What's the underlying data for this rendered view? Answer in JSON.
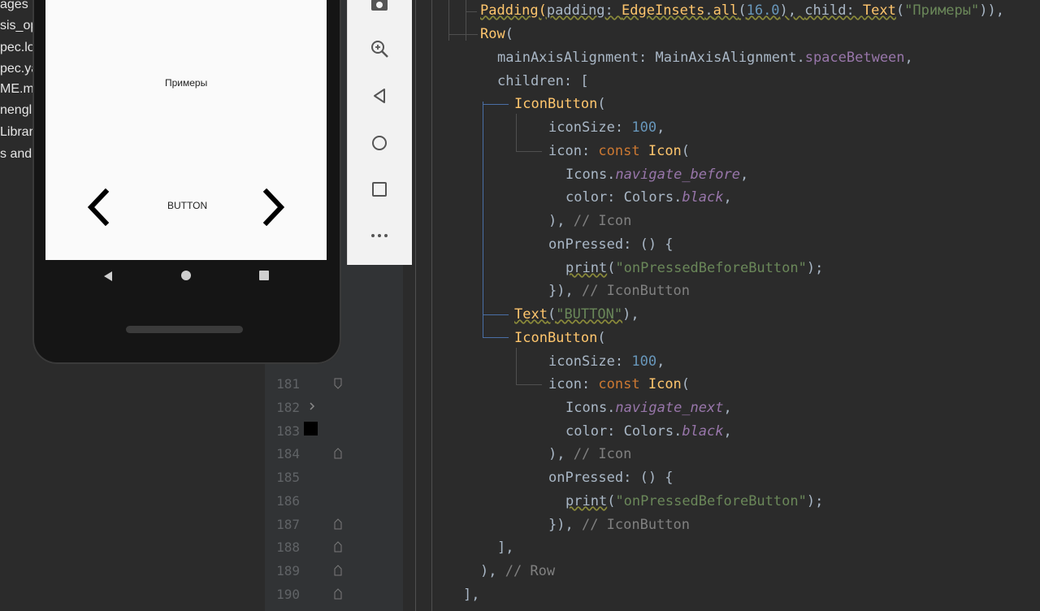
{
  "sidebar": {
    "files": [
      "ages",
      "sis_op",
      "pec.lo",
      "pec.ya",
      "ME.m",
      "nenglis",
      "Librar",
      "s and"
    ]
  },
  "phone": {
    "screen": {
      "title": "Примеры",
      "button_label": "BUTTON",
      "left_icon": "chevron-left-icon",
      "right_icon": "chevron-right-icon"
    },
    "navbar_icons": [
      "back-triangle-icon",
      "home-circle-icon",
      "recents-square-icon"
    ]
  },
  "emulator_toolbar": {
    "tools": [
      "camera-icon",
      "zoom-icon",
      "back-icon",
      "home-icon",
      "overview-icon",
      "more-icon"
    ]
  },
  "editor": {
    "line_numbers": [
      "181",
      "182",
      "183",
      "184",
      "185",
      "186",
      "187",
      "188",
      "189",
      "190"
    ],
    "lines": {
      "l1_a": "Padding(",
      "l1_b": "padding: ",
      "l1_c": "EdgeInsets",
      "l1_d": ".",
      "l1_e": "all",
      "l1_f": "(",
      "l1_g": "16.0",
      "l1_h": "), ",
      "l1_i": "child: ",
      "l1_j": "Text",
      "l1_k": "(",
      "l1_l": "\"Примеры\"",
      "l1_m": ")),",
      "l2_a": "Row",
      "l2_b": "(",
      "l3_a": "mainAxisAlignment: ",
      "l3_b": "MainAxisAlignment.",
      "l3_c": "spaceBetween",
      "l3_d": ",",
      "l4_a": "children: [",
      "l5_a": "IconButton",
      "l5_b": "(",
      "l6_a": "iconSize: ",
      "l6_b": "100",
      "l6_c": ",",
      "l7_a": "icon: ",
      "l7_b": "const ",
      "l7_c": "Icon",
      "l7_d": "(",
      "l8_a": "Icons.",
      "l8_b": "navigate_before",
      "l8_c": ",",
      "l9_a": "color: ",
      "l9_b": "Colors.",
      "l9_c": "black",
      "l9_d": ",",
      "l10_a": "), ",
      "l10_b": "// Icon",
      "l11_a": "onPressed: () {",
      "l12_a": "print",
      "l12_b": "(",
      "l12_c": "\"onPressedBeforeButton\"",
      "l12_d": ");",
      "l13_a": "}), ",
      "l13_b": "// IconButton",
      "l14_a": "Text",
      "l14_b": "(",
      "l14_c": "\"BUTTON\"",
      "l14_d": "),",
      "l15_a": "IconButton",
      "l15_b": "(",
      "l16_a": "iconSize: ",
      "l16_b": "100",
      "l16_c": ",",
      "l17_a": "icon: ",
      "l17_b": "const ",
      "l17_c": "Icon",
      "l17_d": "(",
      "l18_a": "Icons.",
      "l18_b": "navigate_next",
      "l18_c": ",",
      "l19_a": "color: ",
      "l19_b": "Colors.",
      "l19_c": "black",
      "l19_d": ",",
      "l20_a": "), ",
      "l20_b": "// Icon",
      "l21_a": "onPressed: () {",
      "l22_a": "print",
      "l22_b": "(",
      "l22_c": "\"onPressedBeforeButton\"",
      "l22_d": ");",
      "l23_a": "}), ",
      "l23_b": "// IconButton",
      "l24_a": "],",
      "l25_a": "), ",
      "l25_b": "// Row",
      "l26_a": "],"
    }
  }
}
